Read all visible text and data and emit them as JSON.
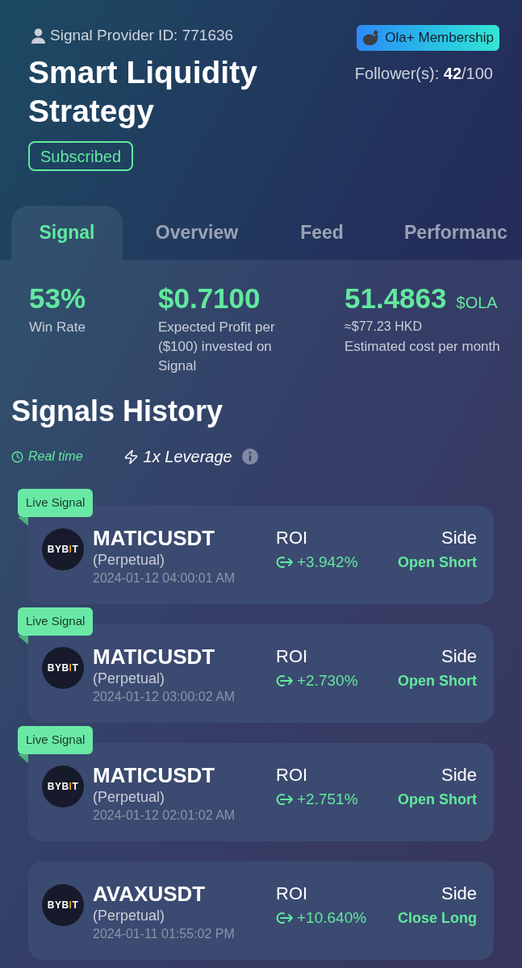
{
  "header": {
    "provider_id": "Signal Provider ID: 771636",
    "title": "Smart Liquidity Strategy",
    "status": "Subscribed",
    "membership": "Ola+ Membership",
    "followers": "Follower(s): **42**/100"
  },
  "tabs": [
    {
      "label": "Signal",
      "selected": true
    },
    {
      "label": "Overview",
      "selected": false
    },
    {
      "label": "Feed",
      "selected": false
    },
    {
      "label": "Performanc",
      "selected": false
    }
  ],
  "stats": [
    {
      "value": "53%",
      "label": "Win Rate"
    },
    {
      "value": "$0.7100",
      "label": "Expected Profit per ($100) invested on Signal"
    },
    {
      "value": "51.4863",
      "unit": "$OLA",
      "sub": "≈$77.23 HKD",
      "label": "Estimated cost per month"
    }
  ],
  "history": {
    "title": "Signals History",
    "mode": "Real time",
    "leverage": "1x Leverage"
  },
  "signals": [
    {
      "live_tag": "Live Signal",
      "exchange_logo": [
        "BYB",
        "I",
        "T"
      ],
      "symbol": "MATICUSDT",
      "contract": "(Perpetual)",
      "time": "2024-01-12 04:00:01 AM",
      "roi_label": "ROI",
      "roi": "+3.942%",
      "side_label": "Side",
      "side": "Open Short"
    },
    {
      "live_tag": "Live Signal",
      "exchange_logo": [
        "BYB",
        "I",
        "T"
      ],
      "symbol": "MATICUSDT",
      "contract": "(Perpetual)",
      "time": "2024-01-12 03:00:02 AM",
      "roi_label": "ROI",
      "roi": "+2.730%",
      "side_label": "Side",
      "side": "Open Short"
    },
    {
      "live_tag": "Live Signal",
      "exchange_logo": [
        "BYB",
        "I",
        "T"
      ],
      "symbol": "MATICUSDT",
      "contract": "(Perpetual)",
      "time": "2024-01-12 02:01:02 AM",
      "roi_label": "ROI",
      "roi": "+2.751%",
      "side_label": "Side",
      "side": "Open Short"
    },
    {
      "exchange_logo": [
        "BYB",
        "I",
        "T"
      ],
      "symbol": "AVAXUSDT",
      "contract": "(Perpetual)",
      "time": "2024-01-11 01:55:02 PM",
      "roi_label": "ROI",
      "roi": "+10.640%",
      "side_label": "Side",
      "side": "Close Long"
    }
  ]
}
